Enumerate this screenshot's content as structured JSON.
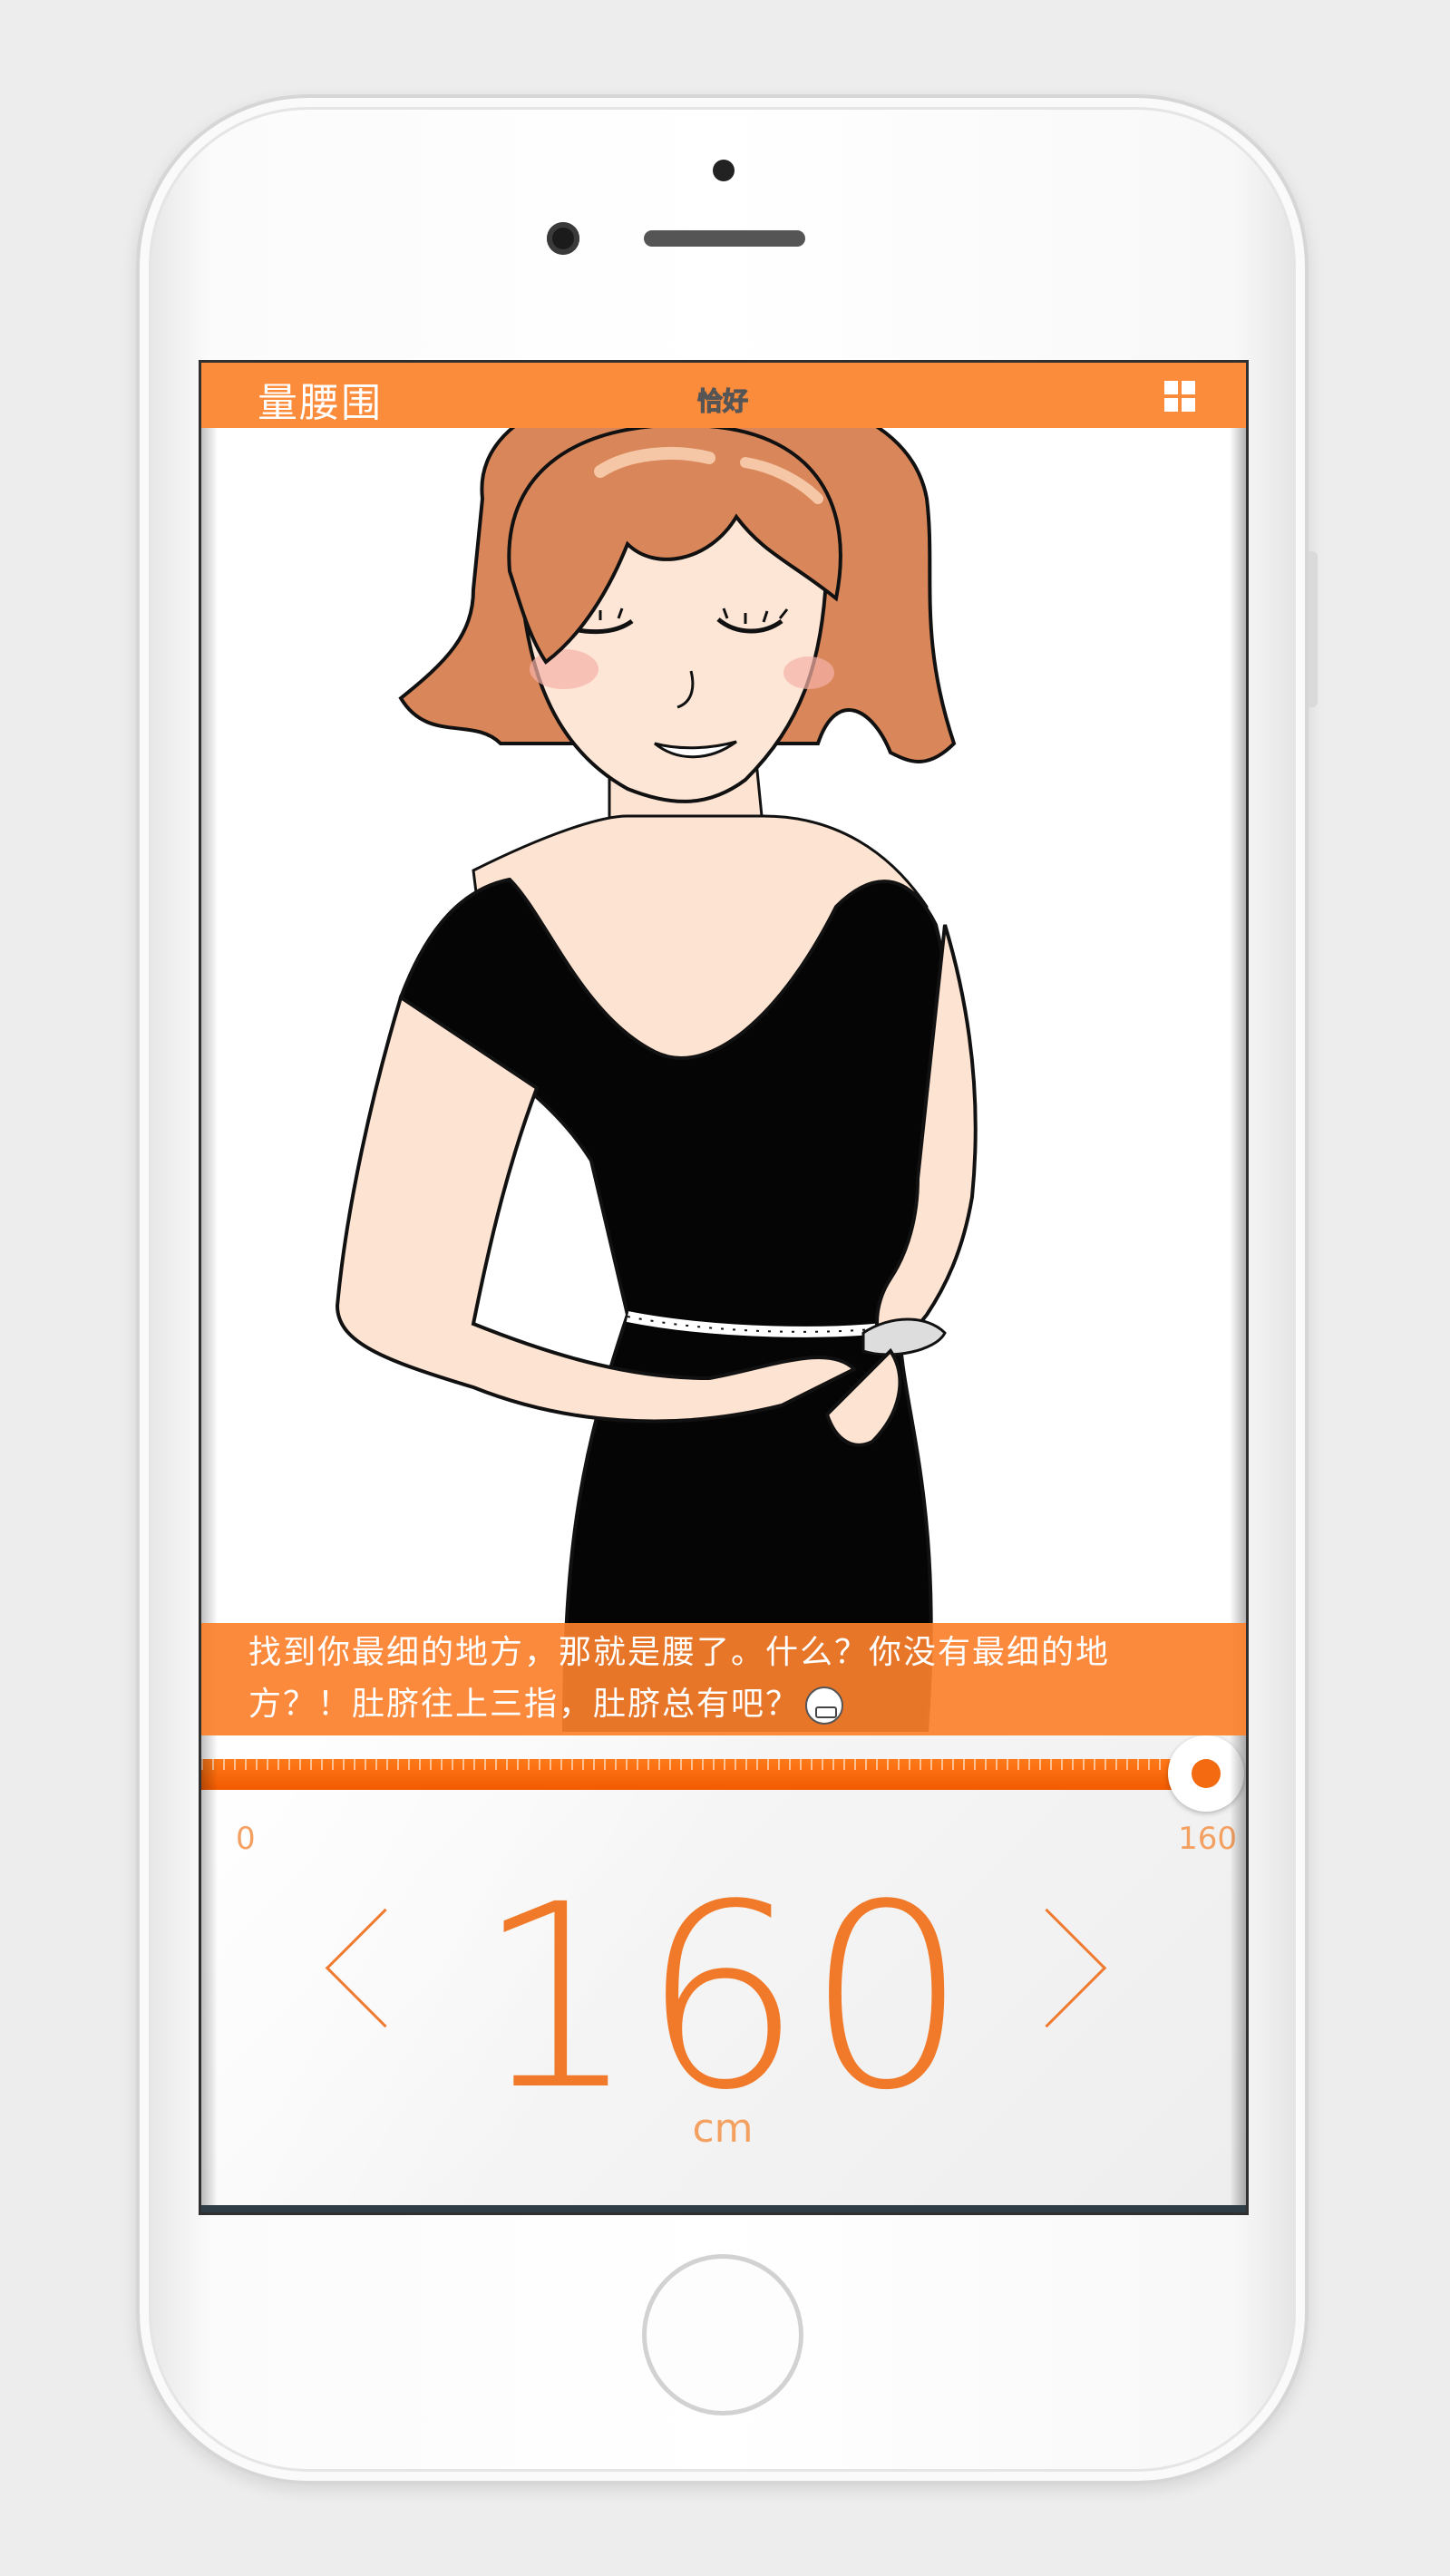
{
  "header": {
    "title": "量腰围",
    "logo_text": "恰好"
  },
  "caption": {
    "text": "找到你最细的地方，那就是腰了。什么？你没有最细的地方？！肚脐往上三指，肚脐总有吧？"
  },
  "slider": {
    "min_label": "0",
    "max_label": "160",
    "value": 160,
    "fraction": 1.0
  },
  "measurement": {
    "value": "160",
    "unit": "cm"
  },
  "colors": {
    "accent": "#fb8c3c",
    "value_text": "#f07a2a",
    "caption_bg": "#fb802c"
  },
  "icons": {
    "menu": "grid-icon",
    "prev": "chevron-left-icon",
    "next": "chevron-right-icon",
    "emoji": "grin-emoji-icon"
  }
}
